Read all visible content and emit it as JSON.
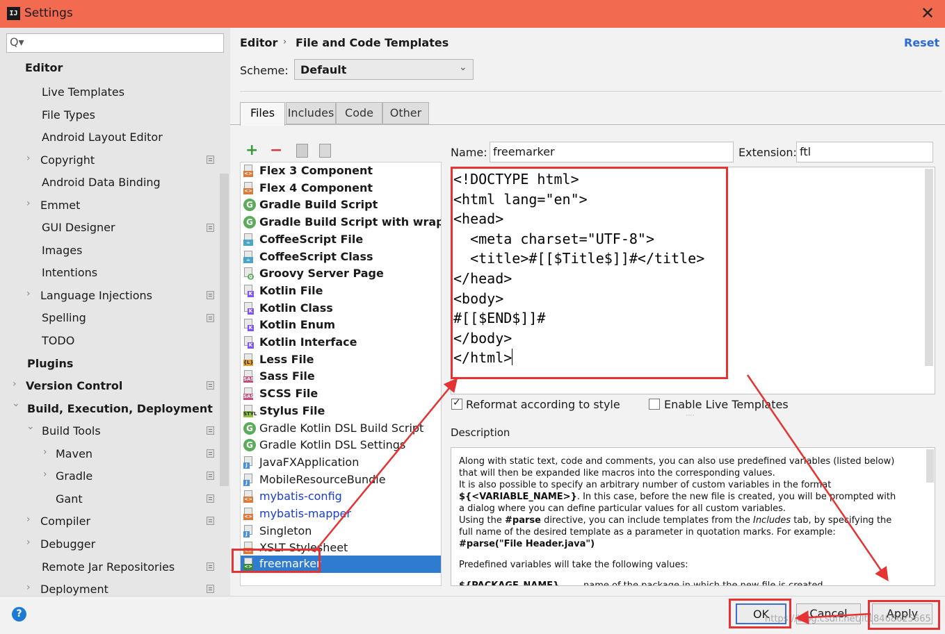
{
  "window": {
    "title": "Settings",
    "app_icon": "IJ",
    "close": "✕"
  },
  "search": {
    "placeholder": "",
    "icon": "search-icon",
    "glyph": "Q▾"
  },
  "sidebar": {
    "items": [
      {
        "label": "Editor",
        "id": "editor"
      },
      {
        "label": "Live Templates",
        "id": "live-templates"
      },
      {
        "label": "File Types",
        "id": "file-types"
      },
      {
        "label": "Android Layout Editor",
        "id": "android-layout-editor"
      },
      {
        "label": "Copyright",
        "id": "copyright"
      },
      {
        "label": "Android Data Binding",
        "id": "android-data-binding"
      },
      {
        "label": "Emmet",
        "id": "emmet"
      },
      {
        "label": "GUI Designer",
        "id": "gui-designer"
      },
      {
        "label": "Images",
        "id": "images"
      },
      {
        "label": "Intentions",
        "id": "intentions"
      },
      {
        "label": "Language Injections",
        "id": "language-injections"
      },
      {
        "label": "Spelling",
        "id": "spelling"
      },
      {
        "label": "TODO",
        "id": "todo"
      },
      {
        "label": "Plugins",
        "id": "plugins"
      },
      {
        "label": "Version Control",
        "id": "version-control"
      },
      {
        "label": "Build, Execution, Deployment",
        "id": "build-execution-deployment"
      },
      {
        "label": "Build Tools",
        "id": "build-tools"
      },
      {
        "label": "Maven",
        "id": "maven"
      },
      {
        "label": "Gradle",
        "id": "gradle"
      },
      {
        "label": "Gant",
        "id": "gant"
      },
      {
        "label": "Compiler",
        "id": "compiler"
      },
      {
        "label": "Debugger",
        "id": "debugger"
      },
      {
        "label": "Remote Jar Repositories",
        "id": "remote-jar-repositories"
      },
      {
        "label": "Deployment",
        "id": "deployment"
      }
    ],
    "chevron_right": "›",
    "chevron_down": "⌄"
  },
  "header": {
    "breadcrumb_root": "Editor",
    "breadcrumb_sep": "›",
    "breadcrumb_page": "File and Code Templates",
    "reset": "Reset",
    "scheme_label": "Scheme:",
    "scheme_value": "Default",
    "scheme_chevron": "⌄"
  },
  "tabs": [
    {
      "label": "Files"
    },
    {
      "label": "Includes"
    },
    {
      "label": "Code"
    },
    {
      "label": "Other"
    }
  ],
  "toolbar": {
    "add": "+",
    "remove": "−"
  },
  "templates": [
    {
      "label": "Flex 3 Component",
      "icon": "mxml-file-icon"
    },
    {
      "label": "Flex 4 Component",
      "icon": "mxml-file-icon"
    },
    {
      "label": "Gradle Build Script",
      "icon": "gradle-icon"
    },
    {
      "label": "Gradle Build Script with wrapper",
      "icon": "gradle-icon"
    },
    {
      "label": "CoffeeScript File",
      "icon": "coffeescript-icon"
    },
    {
      "label": "CoffeeScript Class",
      "icon": "coffeescript-icon"
    },
    {
      "label": "Groovy Server Page",
      "icon": "gsp-icon"
    },
    {
      "label": "Kotlin File",
      "icon": "kotlin-icon"
    },
    {
      "label": "Kotlin Class",
      "icon": "kotlin-icon"
    },
    {
      "label": "Kotlin Enum",
      "icon": "kotlin-icon"
    },
    {
      "label": "Kotlin Interface",
      "icon": "kotlin-icon"
    },
    {
      "label": "Less File",
      "icon": "less-icon"
    },
    {
      "label": "Sass File",
      "icon": "sass-icon"
    },
    {
      "label": "SCSS File",
      "icon": "sass-icon"
    },
    {
      "label": "Stylus File",
      "icon": "stylus-icon"
    },
    {
      "label": "Gradle Kotlin DSL Build Script",
      "icon": "gradle-icon"
    },
    {
      "label": "Gradle Kotlin DSL Settings",
      "icon": "gradle-icon"
    },
    {
      "label": "JavaFXApplication",
      "icon": "java-file-icon"
    },
    {
      "label": "MobileResourceBundle",
      "icon": "java-file-icon"
    },
    {
      "label": "mybatis-config",
      "icon": "xml-file-icon"
    },
    {
      "label": "mybatis-mapper",
      "icon": "xml-file-icon"
    },
    {
      "label": "Singleton",
      "icon": "java-file-icon"
    },
    {
      "label": "XSLT Stylesheet",
      "icon": "xml-file-icon"
    },
    {
      "label": "freemarker",
      "icon": "freemarker-icon"
    }
  ],
  "editor": {
    "name_label": "Name:",
    "name_value": "freemarker",
    "ext_label": "Extension:",
    "ext_value": "ftl",
    "code": "<!DOCTYPE html>\n<html lang=\"en\">\n<head>\n  <meta charset=\"UTF-8\">\n  <title>#[[$Title$]]#</title>\n</head>\n<body>\n#[[$END$]]#\n</body>\n</html>",
    "reformat_label": "Reformat according to style",
    "reformat_checked": true,
    "live_label": "Enable Live Templates",
    "live_checked": false,
    "grip": "·····"
  },
  "description": {
    "label": "Description",
    "lines": [
      "Along with static text, code and comments, you can also use predefined variables (listed below)",
      "that will then be expanded like macros into the corresponding values.",
      "It is also possible to specify an arbitrary number of custom variables in the format",
      "${<VARIABLE_NAME>}",
      ". In this case, before the new file is created, you will be prompted with",
      "a dialog where you can define particular values for all custom variables.",
      "Using the ",
      "#parse",
      " directive, you can include templates from the ",
      "Includes",
      " tab, by specifying the",
      "full name of the desired template as a parameter in quotation marks. For example:",
      "#parse(\"File Header.java\")",
      "Predefined variables will take the following values:",
      "${PACKAGE_NAME}",
      "name of the package in which the new file is created"
    ]
  },
  "footer": {
    "help": "?",
    "ok": "OK",
    "cancel": "Cancel",
    "apply": "Apply",
    "watermark": "https://blog.csdn.net/lt18468625665"
  },
  "colors": {
    "titlebar": "#f26a50",
    "selection": "#2f7bcf",
    "highlight_box": "#e53333",
    "link": "#2d6ad6"
  }
}
